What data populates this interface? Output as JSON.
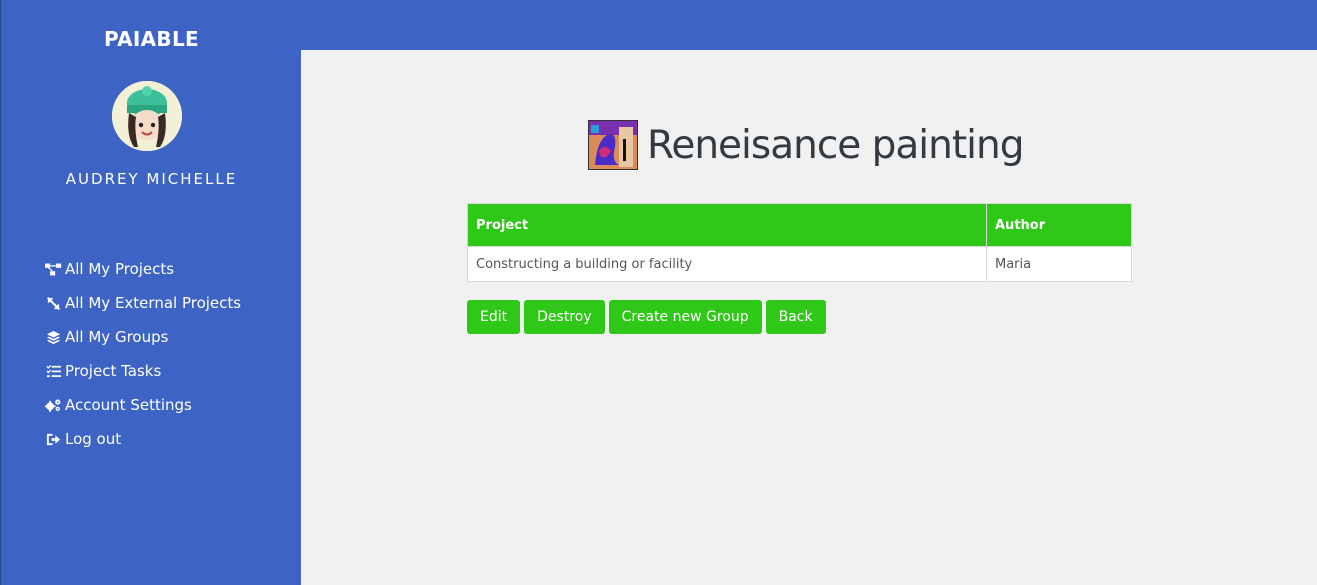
{
  "app": {
    "brand": "PAIABLE"
  },
  "user": {
    "name": "AUDREY MICHELLE"
  },
  "sidebar": {
    "items": [
      {
        "label": "All My Projects",
        "icon": "project-diagram-icon"
      },
      {
        "label": "All My External Projects",
        "icon": "unlink-icon"
      },
      {
        "label": "All My Groups",
        "icon": "layers-icon"
      },
      {
        "label": "Project Tasks",
        "icon": "tasks-icon"
      },
      {
        "label": "Account Settings",
        "icon": "gears-icon"
      },
      {
        "label": "Log out",
        "icon": "sign-out-icon"
      }
    ]
  },
  "main": {
    "title": "Reneisance painting",
    "table": {
      "headers": [
        "Project",
        "Author"
      ],
      "rows": [
        [
          "Constructing a building or facility",
          "Maria"
        ]
      ]
    },
    "actions": {
      "edit": "Edit",
      "destroy": "Destroy",
      "create_group": "Create new Group",
      "back": "Back"
    }
  },
  "colors": {
    "primary": "#3d64c4",
    "accent": "#2fc718",
    "background": "#f0f1f0"
  }
}
